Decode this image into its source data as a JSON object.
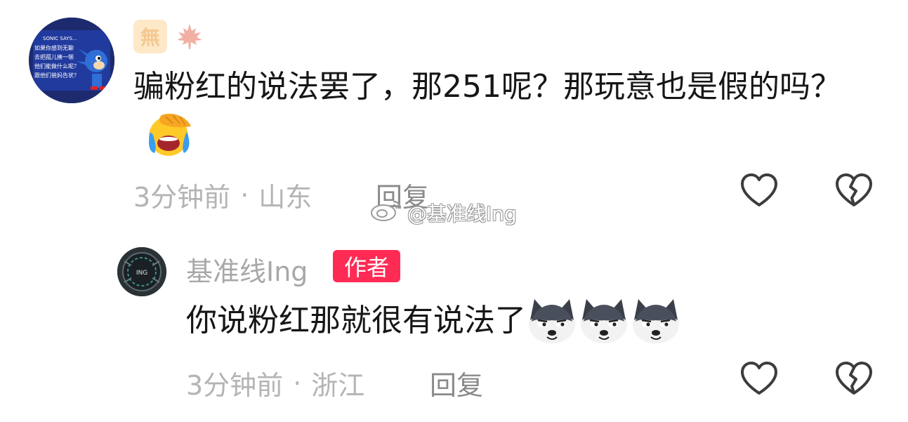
{
  "comments": [
    {
      "badges": {
        "wu_label": "無",
        "leaf_icon": "maple-leaf-icon"
      },
      "text": "骗粉红的说法罢了，那251呢？那玩意也是假的吗？",
      "emoji": "facepalm-laugh-emoji",
      "time": "3分钟前",
      "separator": "·",
      "location": "山东",
      "reply_label": "回复",
      "like_icon": "heart-outline-icon",
      "dislike_icon": "broken-heart-icon"
    },
    {
      "username": "基准线Ing",
      "author_tag": "作者",
      "text": "你说粉红那就很有说法了",
      "emojis": [
        "husky-emoji",
        "husky-emoji",
        "husky-emoji"
      ],
      "time": "3分钟前",
      "separator": "·",
      "location": "浙江",
      "reply_label": "回复",
      "like_icon": "heart-outline-icon",
      "dislike_icon": "broken-heart-icon"
    }
  ],
  "avatars": {
    "c1_lines": [
      "SONIC SAYS...",
      "如果你感到无聊",
      "去把孤儿揍一顿",
      "他们能做什么呢？",
      "跟他们爸妈告状？"
    ],
    "c2_label": "ING"
  },
  "watermark": {
    "icon": "weibo-icon",
    "text": "@基准线Ing"
  },
  "colors": {
    "author_tag": "#fe2c55",
    "meta_text": "#b4b4b4",
    "reply_text": "#8a8a8a",
    "icon_stroke": "#3c3c3c"
  }
}
